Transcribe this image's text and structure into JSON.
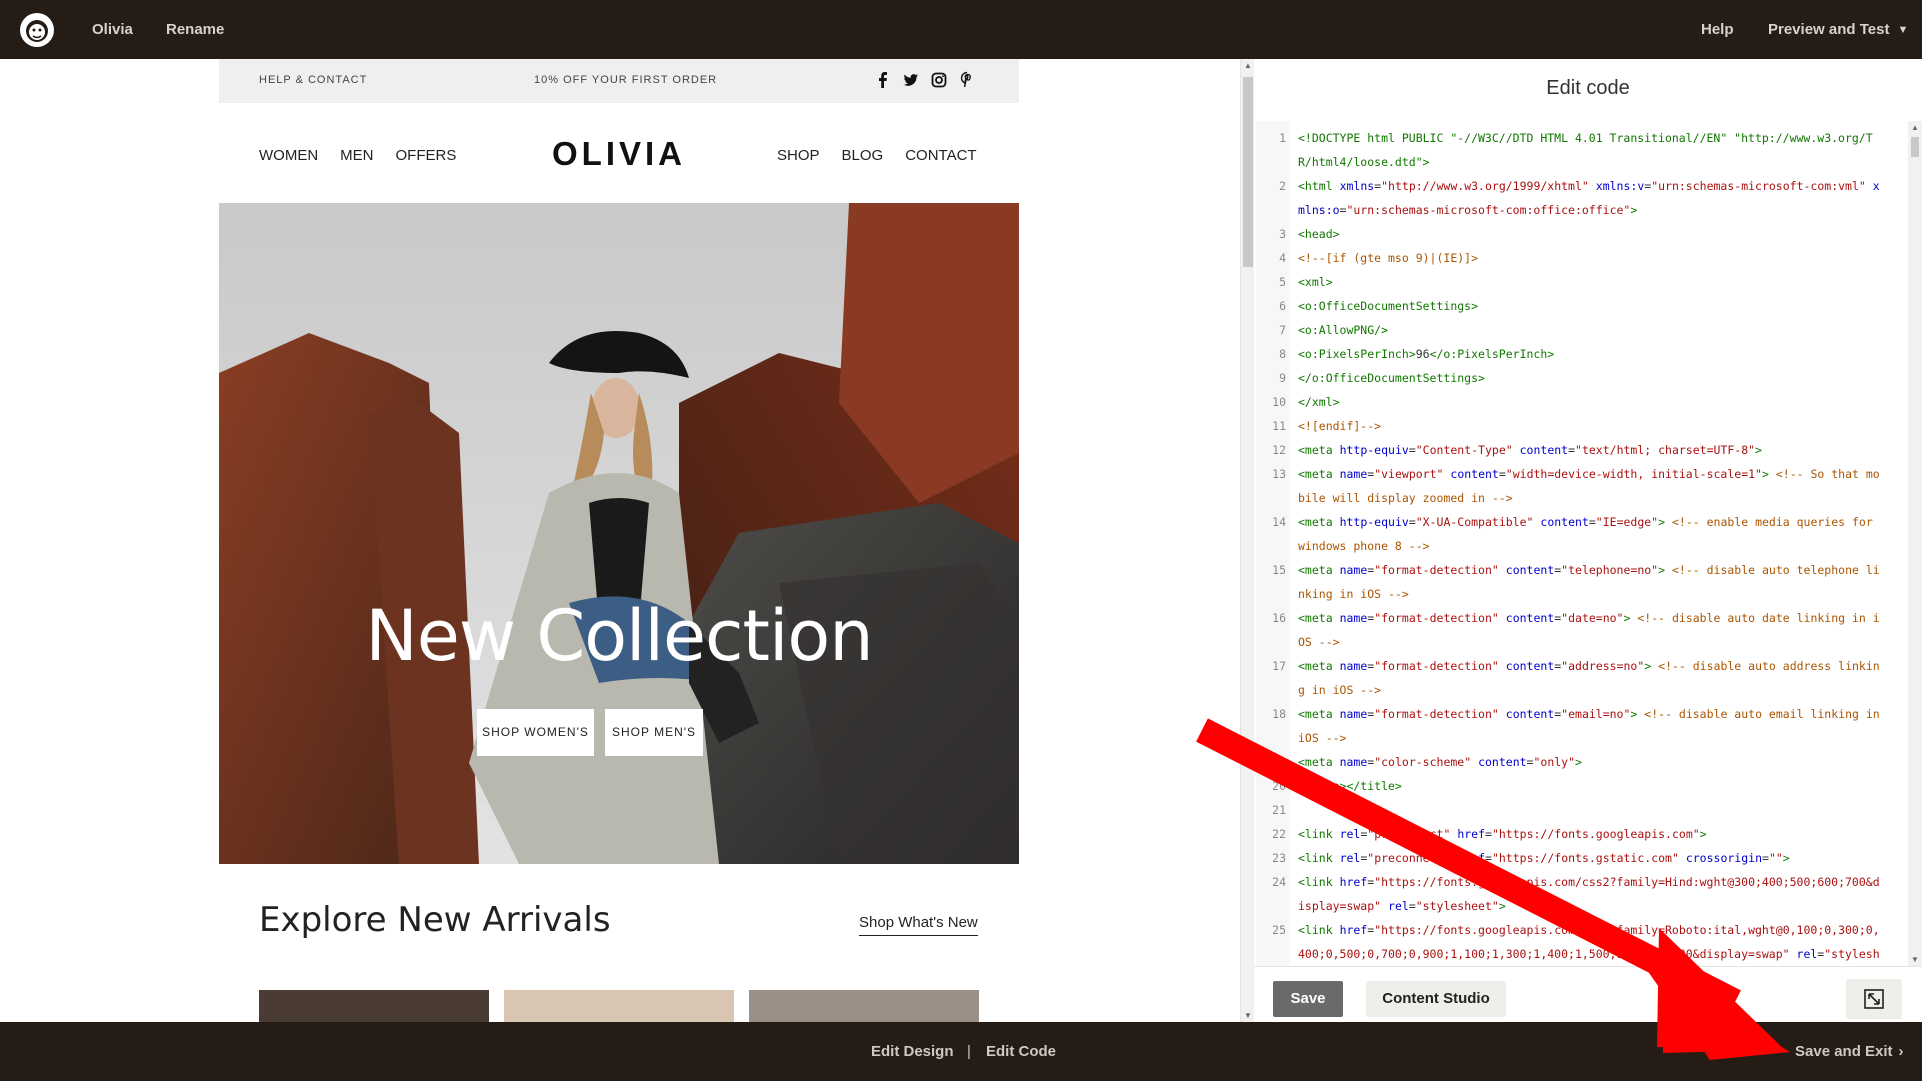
{
  "topbar": {
    "campaign_name": "Olivia",
    "rename_label": "Rename",
    "help_label": "Help",
    "preview_label": "Preview and Test"
  },
  "email": {
    "help_contact": "HELP & CONTACT",
    "offer": "10% OFF YOUR FIRST ORDER",
    "social_icons": [
      "facebook-icon",
      "twitter-icon",
      "instagram-icon",
      "pinterest-icon"
    ],
    "nav_left": [
      "WOMEN",
      "MEN",
      "OFFERS"
    ],
    "brand": "OLIVIA",
    "nav_right": [
      "SHOP",
      "BLOG",
      "CONTACT"
    ],
    "hero_title": "New Collection",
    "hero_buttons": [
      "SHOP WOMEN'S",
      "SHOP MEN'S"
    ],
    "explore_title": "Explore New Arrivals",
    "explore_link": "Shop What's New"
  },
  "editor": {
    "title": "Edit code",
    "lines": [
      {
        "n": "1",
        "html": "<span class='tag'>&lt;!DOCTYPE html PUBLIC \"-//W3C//DTD HTML 4.01 Transitional//EN\" \"http://www.w3.org/T</span>"
      },
      {
        "n": "",
        "html": "<span class='tag'>R/html4/loose.dtd\"&gt;</span>"
      },
      {
        "n": "2",
        "html": "<span class='tag'>&lt;html</span> <span class='att'>xmlns</span>=<span class='str'>\"http://www.w3.org/1999/xhtml\"</span> <span class='att'>xmlns:v</span>=<span class='str'>\"urn:schemas-microsoft-com:vml\"</span> <span class='att'>x</span>"
      },
      {
        "n": "",
        "html": "<span class='att'>mlns:o</span>=<span class='str'>\"urn:schemas-microsoft-com:office:office\"</span><span class='tag'>&gt;</span>"
      },
      {
        "n": "3",
        "html": "<span class='tag'>&lt;head&gt;</span>"
      },
      {
        "n": "4",
        "html": "<span class='cmt'>&lt;!--[if (gte mso 9)|(IE)]&gt;</span>"
      },
      {
        "n": "5",
        "html": "  <span class='tag'>&lt;xml&gt;</span>"
      },
      {
        "n": "6",
        "html": "    <span class='tag'>&lt;o:OfficeDocumentSettings&gt;</span>"
      },
      {
        "n": "7",
        "html": "    <span class='tag'>&lt;o:AllowPNG/&gt;</span>"
      },
      {
        "n": "8",
        "html": "    <span class='tag'>&lt;o:PixelsPerInch&gt;</span>96<span class='tag'>&lt;/o:PixelsPerInch&gt;</span>"
      },
      {
        "n": "9",
        "html": "  <span class='tag'>&lt;/o:OfficeDocumentSettings&gt;</span>"
      },
      {
        "n": "10",
        "html": "<span class='tag'>&lt;/xml&gt;</span>"
      },
      {
        "n": "11",
        "html": "<span class='cmt'>&lt;![endif]--&gt;</span>"
      },
      {
        "n": "12",
        "html": "<span class='tag'>&lt;meta</span> <span class='att'>http-equiv</span>=<span class='str'>\"Content-Type\"</span> <span class='att'>content</span>=<span class='str'>\"text/html; charset=UTF-8\"</span><span class='tag'>&gt;</span>"
      },
      {
        "n": "13",
        "html": "<span class='tag'>&lt;meta</span> <span class='att'>name</span>=<span class='str'>\"viewport\"</span> <span class='att'>content</span>=<span class='str'>\"width=device-width, initial-scale=1\"</span><span class='tag'>&gt;</span> <span class='cmt'>&lt;!-- So that mo</span>"
      },
      {
        "n": "",
        "html": "<span class='cmt'>bile will display zoomed in --&gt;</span>"
      },
      {
        "n": "14",
        "html": "<span class='tag'>&lt;meta</span> <span class='att'>http-equiv</span>=<span class='str'>\"X-UA-Compatible\"</span> <span class='att'>content</span>=<span class='str'>\"IE=edge\"</span><span class='tag'>&gt;</span> <span class='cmt'>&lt;!-- enable media queries for</span>"
      },
      {
        "n": "",
        "html": "<span class='cmt'>windows phone 8 --&gt;</span>"
      },
      {
        "n": "15",
        "html": "<span class='tag'>&lt;meta</span> <span class='att'>name</span>=<span class='str'>\"format-detection\"</span> <span class='att'>content</span>=<span class='str'>\"telephone=no\"</span><span class='tag'>&gt;</span> <span class='cmt'>&lt;!-- disable auto telephone li</span>"
      },
      {
        "n": "",
        "html": "<span class='cmt'>nking in iOS --&gt;</span>"
      },
      {
        "n": "16",
        "html": "<span class='tag'>&lt;meta</span> <span class='att'>name</span>=<span class='str'>\"format-detection\"</span> <span class='att'>content</span>=<span class='str'>\"date=no\"</span><span class='tag'>&gt;</span> <span class='cmt'>&lt;!-- disable auto date linking in i</span>"
      },
      {
        "n": "",
        "html": "<span class='cmt'>OS --&gt;</span>"
      },
      {
        "n": "17",
        "html": "<span class='tag'>&lt;meta</span> <span class='att'>name</span>=<span class='str'>\"format-detection\"</span> <span class='att'>content</span>=<span class='str'>\"address=no\"</span><span class='tag'>&gt;</span> <span class='cmt'>&lt;!-- disable auto address linkin</span>"
      },
      {
        "n": "",
        "html": "<span class='cmt'>g in iOS --&gt;</span>"
      },
      {
        "n": "18",
        "html": "<span class='tag'>&lt;meta</span> <span class='att'>name</span>=<span class='str'>\"format-detection\"</span> <span class='att'>content</span>=<span class='str'>\"email=no\"</span><span class='tag'>&gt;</span> <span class='cmt'>&lt;!-- disable auto email linking in</span>"
      },
      {
        "n": "",
        "html": "<span class='cmt'>iOS --&gt;</span>"
      },
      {
        "n": "19",
        "html": "<span class='tag'>&lt;meta</span> <span class='att'>name</span>=<span class='str'>\"color-scheme\"</span> <span class='att'>content</span>=<span class='str'>\"only\"</span><span class='tag'>&gt;</span>"
      },
      {
        "n": "20",
        "html": "<span class='tag'>&lt;title&gt;&lt;/title&gt;</span>"
      },
      {
        "n": "21",
        "html": ""
      },
      {
        "n": "22",
        "html": "<span class='tag'>&lt;link</span> <span class='att'>rel</span>=<span class='str'>\"preconnect\"</span> <span class='att'>href</span>=<span class='str'>\"https://fonts.googleapis.com\"</span><span class='tag'>&gt;</span>"
      },
      {
        "n": "23",
        "html": "<span class='tag'>&lt;link</span> <span class='att'>rel</span>=<span class='str'>\"preconnect\"</span> <span class='att'>href</span>=<span class='str'>\"https://fonts.gstatic.com\"</span> <span class='att'>crossorigin</span>=<span class='str'>\"\"</span><span class='tag'>&gt;</span>"
      },
      {
        "n": "24",
        "html": "<span class='tag'>&lt;link</span> <span class='att'>href</span>=<span class='str'>\"https://fonts.googleapis.com/css2?family=Hind:wght@300;400;500;600;700&amp;d</span>"
      },
      {
        "n": "",
        "html": "<span class='str'>isplay=swap\"</span> <span class='att'>rel</span>=<span class='str'>\"stylesheet\"</span><span class='tag'>&gt;</span>"
      },
      {
        "n": "25",
        "html": "<span class='tag'>&lt;link</span> <span class='att'>href</span>=<span class='str'>\"https://fonts.googleapis.com/css2?family=Roboto:ital,wght@0,100;0,300;0,</span>"
      },
      {
        "n": "",
        "html": "<span class='str'>400;0,500;0,700;0,900;1,100;1,300;1,400;1,500;1,700;1,900&amp;display=swap\"</span> <span class='att'>rel</span>=<span class='str'>\"stylesh</span>"
      }
    ],
    "save_label": "Save",
    "content_studio_label": "Content Studio"
  },
  "bottombar": {
    "edit_design": "Edit Design",
    "separator": "|",
    "edit_code": "Edit Code",
    "save_exit": "Save and Exit"
  },
  "colors": {
    "topbar_bg": "#241c15",
    "arrow": "#ff0000"
  }
}
